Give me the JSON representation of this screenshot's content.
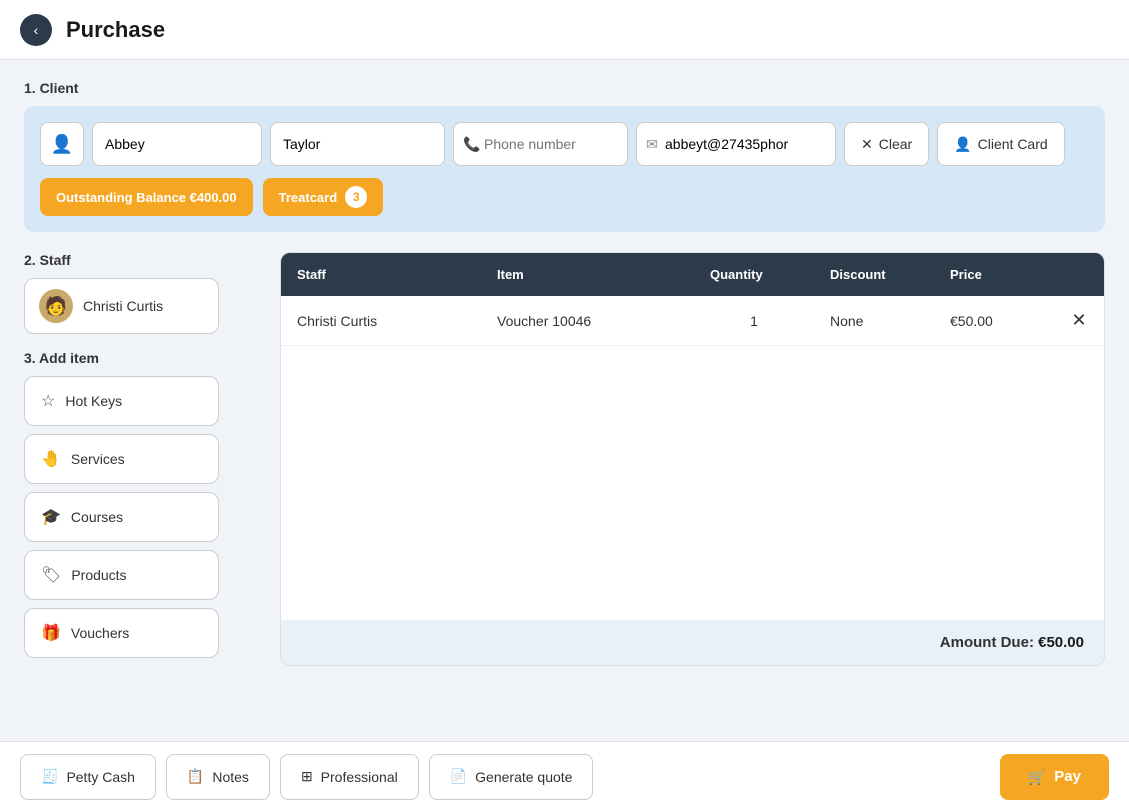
{
  "header": {
    "back_icon": "‹",
    "title": "Purchase"
  },
  "client_section": {
    "label": "1. Client",
    "first_name": "Abbey",
    "last_name": "Taylor",
    "phone_placeholder": "Phone number",
    "email": "abbeyt@27435phor",
    "clear_label": "Clear",
    "client_card_label": "Client Card",
    "outstanding_balance_label": "Outstanding Balance €400.00",
    "treatcard_label": "Treatcard",
    "treatcard_count": "3"
  },
  "staff_section": {
    "label": "2. Staff",
    "staff_name": "Christi Curtis"
  },
  "add_item_section": {
    "label": "3. Add item",
    "buttons": [
      {
        "id": "hot-keys",
        "icon": "☆",
        "label": "Hot Keys"
      },
      {
        "id": "services",
        "icon": "✋",
        "label": "Services"
      },
      {
        "id": "courses",
        "icon": "🎓",
        "label": "Courses"
      },
      {
        "id": "products",
        "icon": "🏷",
        "label": "Products"
      },
      {
        "id": "vouchers",
        "icon": "🎁",
        "label": "Vouchers"
      }
    ]
  },
  "table": {
    "headers": [
      "Staff",
      "Item",
      "Quantity",
      "Discount",
      "Price",
      ""
    ],
    "rows": [
      {
        "staff": "Christi Curtis",
        "item": "Voucher 10046",
        "quantity": "1",
        "discount": "None",
        "price": "€50.00"
      }
    ],
    "amount_due_label": "Amount Due:",
    "amount_due_value": "€50.00"
  },
  "bottom_bar": {
    "petty_cash_label": "Petty Cash",
    "notes_label": "Notes",
    "professional_label": "Professional",
    "generate_quote_label": "Generate quote",
    "pay_label": "Pay"
  }
}
